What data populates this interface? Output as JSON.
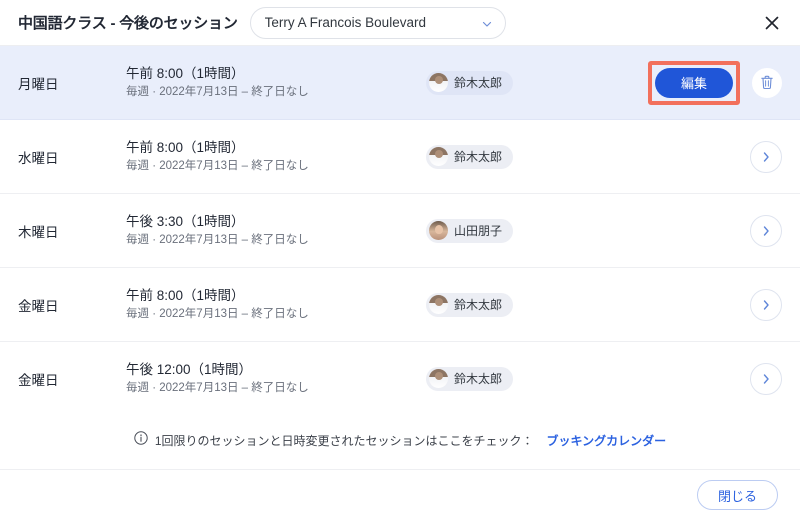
{
  "header": {
    "title": "中国語クラス - 今後のセッション",
    "location_select": {
      "value": "Terry A Francois Boulevard",
      "icon": "chevron-down-icon"
    },
    "close_icon": "close-icon"
  },
  "sessions": [
    {
      "day": "月曜日",
      "time": "午前 8:00（1時間）",
      "recurrence": "毎週 · 2022年7月13日 – 終了日なし",
      "staff": "鈴木太郎",
      "avatar_kind": "male",
      "selected": true,
      "edit_label": "編集",
      "delete_icon": "trash-icon",
      "highlighted": true
    },
    {
      "day": "水曜日",
      "time": "午前 8:00（1時間）",
      "recurrence": "毎週 · 2022年7月13日 – 終了日なし",
      "staff": "鈴木太郎",
      "avatar_kind": "male",
      "selected": false,
      "chevron_icon": "chevron-right-icon"
    },
    {
      "day": "木曜日",
      "time": "午後 3:30（1時間）",
      "recurrence": "毎週 · 2022年7月13日 – 終了日なし",
      "staff": "山田朋子",
      "avatar_kind": "female",
      "selected": false,
      "chevron_icon": "chevron-right-icon"
    },
    {
      "day": "金曜日",
      "time": "午前 8:00（1時間）",
      "recurrence": "毎週 · 2022年7月13日 – 終了日なし",
      "staff": "鈴木太郎",
      "avatar_kind": "male",
      "selected": false,
      "chevron_icon": "chevron-right-icon"
    },
    {
      "day": "金曜日",
      "time": "午後 12:00（1時間）",
      "recurrence": "毎週 · 2022年7月13日 – 終了日なし",
      "staff": "鈴木太郎",
      "avatar_kind": "male",
      "selected": false,
      "chevron_icon": "chevron-right-icon"
    }
  ],
  "info_note": {
    "icon": "info-icon",
    "text": "1回限りのセッションと日時変更されたセッションはここをチェック：",
    "link_label": "ブッキングカレンダー"
  },
  "footer": {
    "close_label": "閉じる"
  },
  "colors": {
    "primary_blue": "#2056d8",
    "link_blue": "#2c62e0",
    "selected_row_bg": "#e9eefb",
    "highlight_box": "#f2705c",
    "chip_bg": "#eceef4"
  }
}
